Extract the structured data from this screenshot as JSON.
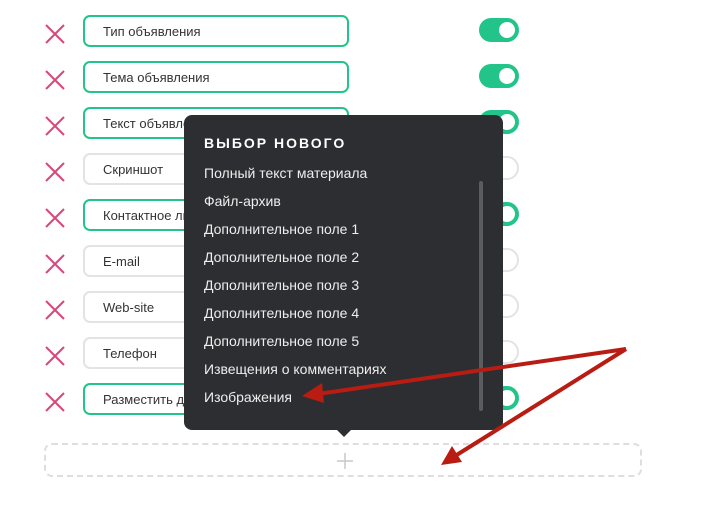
{
  "fields": [
    {
      "label": "Тип объявления",
      "enabled": true
    },
    {
      "label": "Тема объявления",
      "enabled": true
    },
    {
      "label": "Текст объявления",
      "enabled": true
    },
    {
      "label": "Скриншот",
      "enabled": false
    },
    {
      "label": "Контактное лицо",
      "enabled": true
    },
    {
      "label": "E-mail",
      "enabled": false
    },
    {
      "label": "Web-site",
      "enabled": false
    },
    {
      "label": "Телефон",
      "enabled": false
    },
    {
      "label": "Разместить до",
      "enabled": true
    }
  ],
  "colors": {
    "accent": "#22c489",
    "delete": "#d9477a",
    "popup_bg": "#2c2e31",
    "arrow": "#b81c12"
  },
  "icons": {
    "delete": "close-icon",
    "add": "plus-icon"
  },
  "popup": {
    "title": "ВЫБОР НОВОГО",
    "items": [
      "Полный текст материала",
      "Файл-архив",
      "Дополнительное поле 1",
      "Дополнительное поле 2",
      "Дополнительное поле 3",
      "Дополнительное поле 4",
      "Дополнительное поле 5",
      "Извещения о комментариях",
      "Изображения"
    ]
  }
}
